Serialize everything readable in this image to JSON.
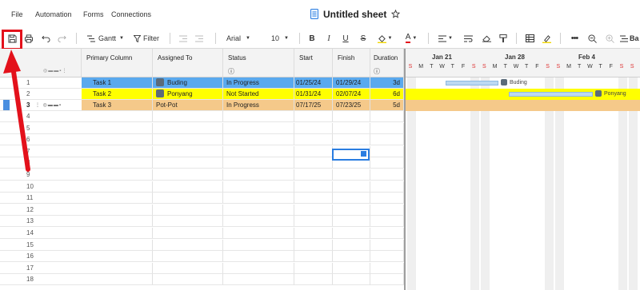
{
  "menu": {
    "items": [
      "File",
      "Automation",
      "Forms",
      "Connections"
    ]
  },
  "doc": {
    "title": "Untitled sheet"
  },
  "toolbar": {
    "view_label": "Gantt",
    "filter_label": "Filter",
    "font_label": "Arial",
    "size_label": "10",
    "overflow_label": "Ba"
  },
  "columns": {
    "primary": "Primary Column",
    "assigned": "Assigned To",
    "status": "Status",
    "start": "Start",
    "finish": "Finish",
    "duration": "Duration"
  },
  "rows": [
    {
      "num": "1",
      "task": "Task 1",
      "assigned": "Buding",
      "status": "In Progress",
      "start": "01/25/24",
      "finish": "01/29/24",
      "duration": "3d",
      "color": "#5aa9ee"
    },
    {
      "num": "2",
      "task": "Task 2",
      "assigned": "Ponyang",
      "status": "Not Started",
      "start": "01/31/24",
      "finish": "02/07/24",
      "duration": "6d",
      "color": "#ffff00"
    },
    {
      "num": "3",
      "task": "Task 3",
      "assigned": "Pot-Pot",
      "status": "In Progress",
      "start": "07/17/25",
      "finish": "07/23/25",
      "duration": "5d",
      "color": "#f5c98a"
    }
  ],
  "empty_row_numbers": [
    "4",
    "5",
    "6",
    "7",
    "8",
    "9",
    "10",
    "11",
    "12",
    "13",
    "14",
    "15",
    "16",
    "17",
    "18"
  ],
  "gantt": {
    "weeks": [
      "Jan 21",
      "Jan 28",
      "Feb 4"
    ],
    "days": [
      "S",
      "M",
      "T",
      "W",
      "T",
      "F",
      "S",
      "S",
      "M",
      "T",
      "W",
      "T",
      "F",
      "S",
      "S",
      "M",
      "T",
      "W",
      "T",
      "F",
      "S",
      "S"
    ],
    "bar_labels": [
      "Buding",
      "Ponyang"
    ]
  },
  "colors": {
    "highlight": "#e3111b",
    "task1": "#5aa9ee",
    "task2": "#ffff00",
    "task3": "#f5c98a"
  }
}
